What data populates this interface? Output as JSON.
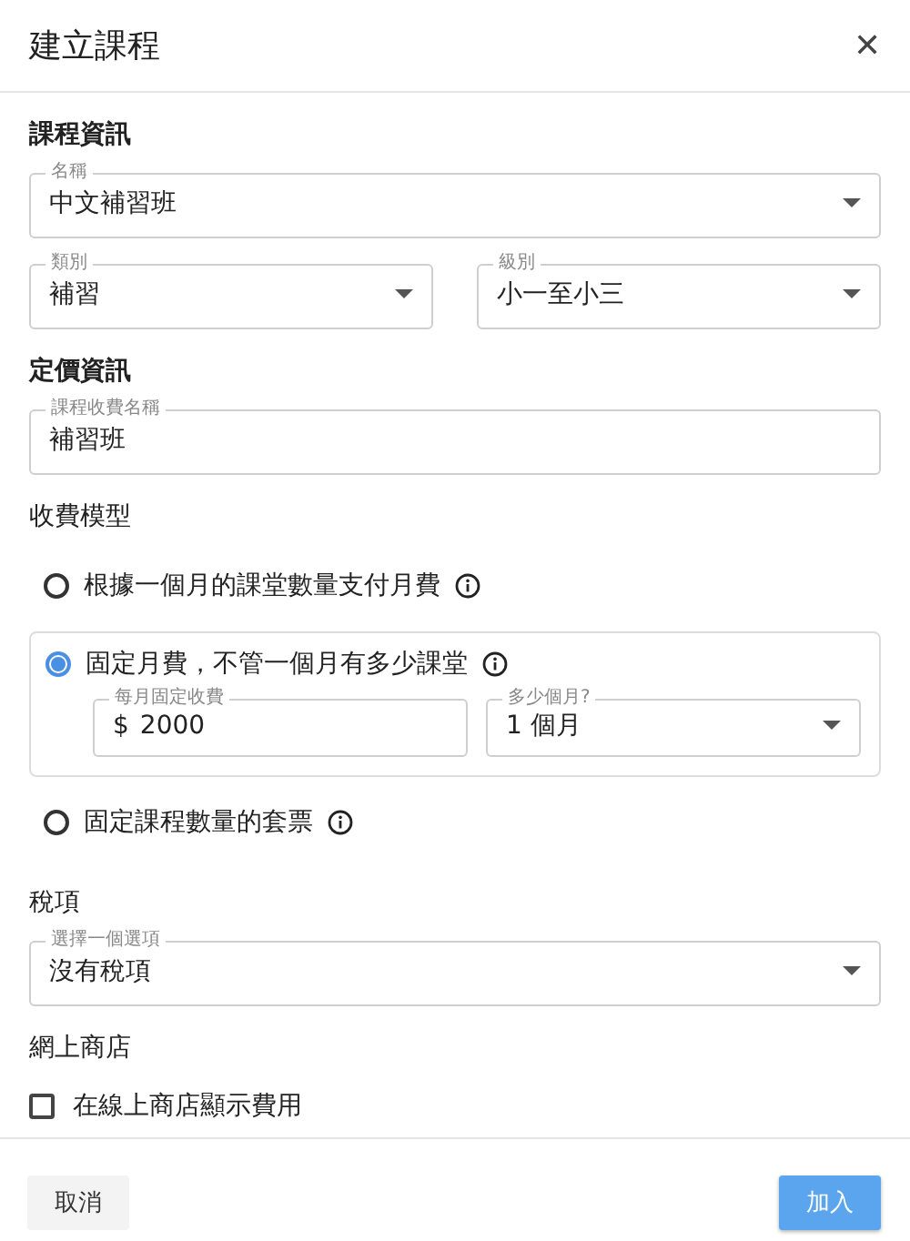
{
  "dialog": {
    "title": "建立課程",
    "close": "✕"
  },
  "sections": [
    {
      "title": "課程資訊",
      "rows": [
        [
          {
            "kind": "select",
            "label": "名稱",
            "value": "中文補習班"
          }
        ],
        [
          {
            "kind": "select",
            "label": "類別",
            "value": "補習"
          },
          {
            "kind": "select",
            "label": "級別",
            "value": "小一至小三"
          }
        ]
      ]
    },
    {
      "title": "定價資訊",
      "rows": [
        [
          {
            "kind": "text",
            "label": "課程收費名稱",
            "value": "補習班"
          }
        ]
      ]
    }
  ],
  "pricing_model": {
    "title": "收費模型",
    "options": [
      {
        "label": "根據一個月的課堂數量支付月費",
        "selected": false
      },
      {
        "label": "固定月費，不管一個月有多少課堂",
        "selected": true,
        "fields": [
          {
            "kind": "text",
            "label": "每月固定收費",
            "prefix": "$",
            "value": "2000"
          },
          {
            "kind": "select",
            "label": "多少個月?",
            "value": "1 個月"
          }
        ]
      },
      {
        "label": "固定課程數量的套票",
        "selected": false
      }
    ]
  },
  "tax": {
    "title": "稅項",
    "field": {
      "kind": "select",
      "label": "選擇一個選項",
      "value": "沒有稅項"
    }
  },
  "online_store": {
    "title": "網上商店",
    "checkbox": {
      "label": "在線上商店顯示費用",
      "checked": false
    }
  },
  "buttons": [
    {
      "kind": "secondary",
      "label": "取消"
    },
    {
      "kind": "primary",
      "label": "加入"
    }
  ]
}
